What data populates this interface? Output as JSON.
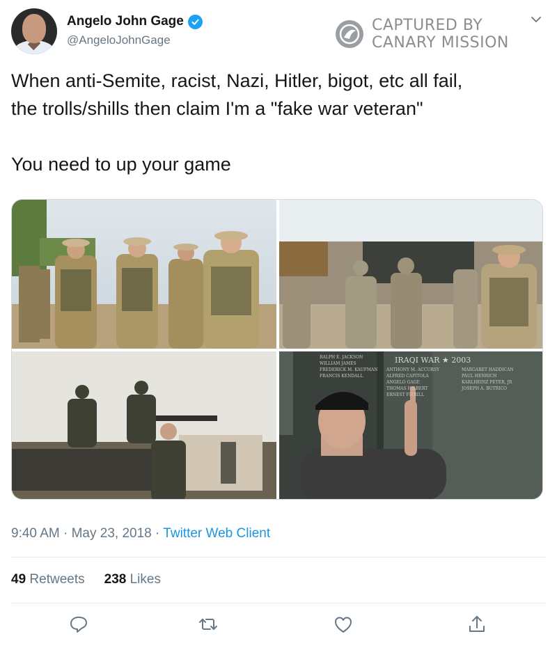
{
  "tweet": {
    "display_name": "Angelo John Gage",
    "handle": "@AngeloJohnGage",
    "text_line1": "When anti-Semite, racist, Nazi, Hitler, bigot, etc all fail,",
    "text_line2": "the trolls/shills then claim I'm a \"fake war veteran\"",
    "text_line3": "You need to up your game",
    "time": "9:40 AM",
    "separator": "·",
    "date": "May 23, 2018",
    "client": "Twitter Web Client",
    "retweets_count": "49",
    "retweets_label": "Retweets",
    "likes_count": "238",
    "likes_label": "Likes"
  },
  "watermark": {
    "line1": "CAPTURED BY",
    "line2": "CANARY MISSION"
  },
  "memorial_wall": {
    "heading": "IRAQI WAR ★ 2003",
    "names_left": [
      "RALPH E. JACKSON",
      "WILLIAM JAMES",
      "FREDERICK M. KAUFMAN",
      "FRANCIS KENDALL"
    ],
    "names_middle": [
      "ANTHONY M. ACCURSY",
      "ALFRED CAPITOLA",
      "ANGELO GAGE",
      "THOMAS HILBERT",
      "ERNEST FITRILL"
    ],
    "names_right": [
      "MARGARET HADDICAN",
      "PAUL HENRICH",
      "KARLHEINZ PETER, JR",
      "JOSEPH A. BUTRICO"
    ]
  },
  "icons": [
    "verified-icon",
    "chevron-down-icon",
    "reply-icon",
    "retweet-icon",
    "like-icon",
    "share-icon"
  ],
  "colors": {
    "accent": "#1da1f2",
    "link": "#1b95e0",
    "muted": "#657786"
  }
}
